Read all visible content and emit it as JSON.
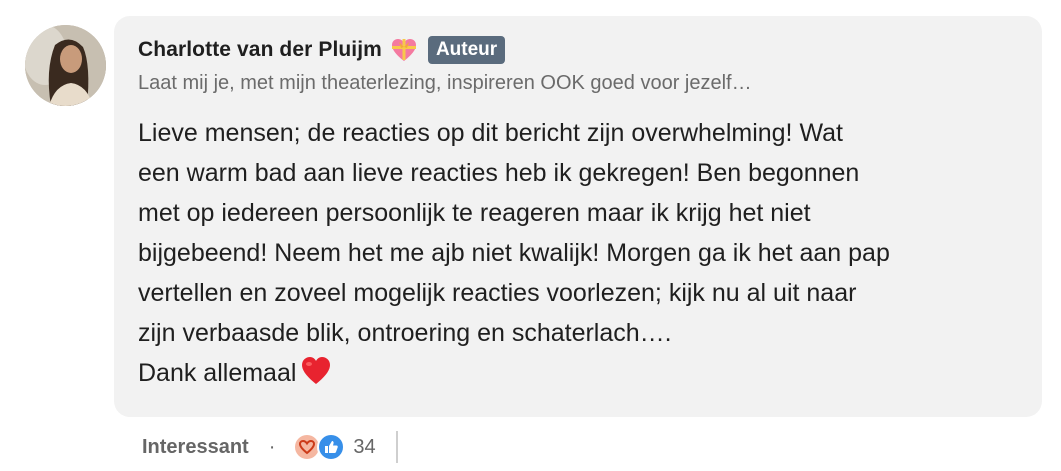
{
  "comment": {
    "author": "Charlotte van der Pluijm",
    "badge": "Auteur",
    "headline": "Laat mij je, met mijn theaterlezing, inspireren OOK goed voor jezelf…",
    "body_lines": [
      "Lieve mensen; de reacties op dit bericht zijn overwhelming! Wat",
      "een warm bad aan lieve reacties heb ik gekregen! Ben begonnen",
      "met op iedereen persoonlijk te reageren maar ik krijg het niet",
      "bijgebeend! Neem het me ajb niet kwalijk! Morgen ga ik het aan pap",
      "vertellen en zoveel mogelijk reacties voorlezen; kijk nu al uit naar",
      "zijn verbaasde blik, ontroering en schaterlach….",
      "Dank allemaal"
    ],
    "name_emoji": "heart-with-ribbon-icon",
    "closing_emoji": "red-heart-icon"
  },
  "actions": {
    "reaction_label": "Interessant",
    "separator": "·",
    "reaction_count": "34",
    "reaction_icons": [
      "love-reaction-icon",
      "like-reaction-icon"
    ]
  },
  "colors": {
    "bubble_bg": "#f2f2f2",
    "badge_bg": "#5a6b7d",
    "muted_text": "#6b6b6b",
    "like_blue": "#378fe9",
    "love_peach": "#f5b7a1"
  }
}
